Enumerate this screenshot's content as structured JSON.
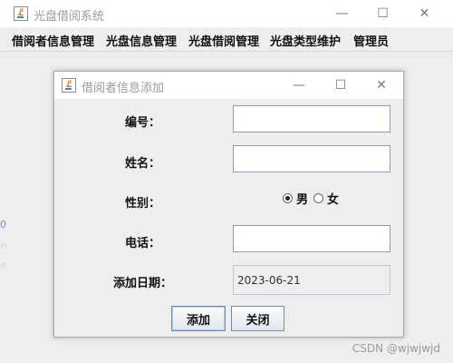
{
  "main_window": {
    "title": "光盘借阅系统",
    "menu": [
      "借阅者信息管理",
      "光盘信息管理",
      "光盘借阅管理",
      "光盘类型维护",
      "管理员"
    ],
    "side_fragments": [
      "0",
      "n",
      "e"
    ]
  },
  "window_controls": {
    "minimize": "—",
    "maximize": "☐",
    "close": "✕"
  },
  "dialog": {
    "title": "借阅者信息添加",
    "labels": {
      "id": "编号：",
      "name": "姓名：",
      "gender": "性别：",
      "phone": "电话：",
      "date": "添加日期："
    },
    "fields": {
      "id": "",
      "name": "",
      "phone": "",
      "date": "2023-06-21"
    },
    "gender_options": [
      "男",
      "女"
    ],
    "gender_selected": "男",
    "buttons": {
      "add": "添加",
      "close": "关闭"
    }
  },
  "watermark": "CSDN @wjwjwjd",
  "colors": {
    "title_text": "#9a9a9a",
    "field_border": "#8a9db3",
    "background": "#eeeeee"
  },
  "icons": {
    "app": "java-coffee-icon"
  }
}
